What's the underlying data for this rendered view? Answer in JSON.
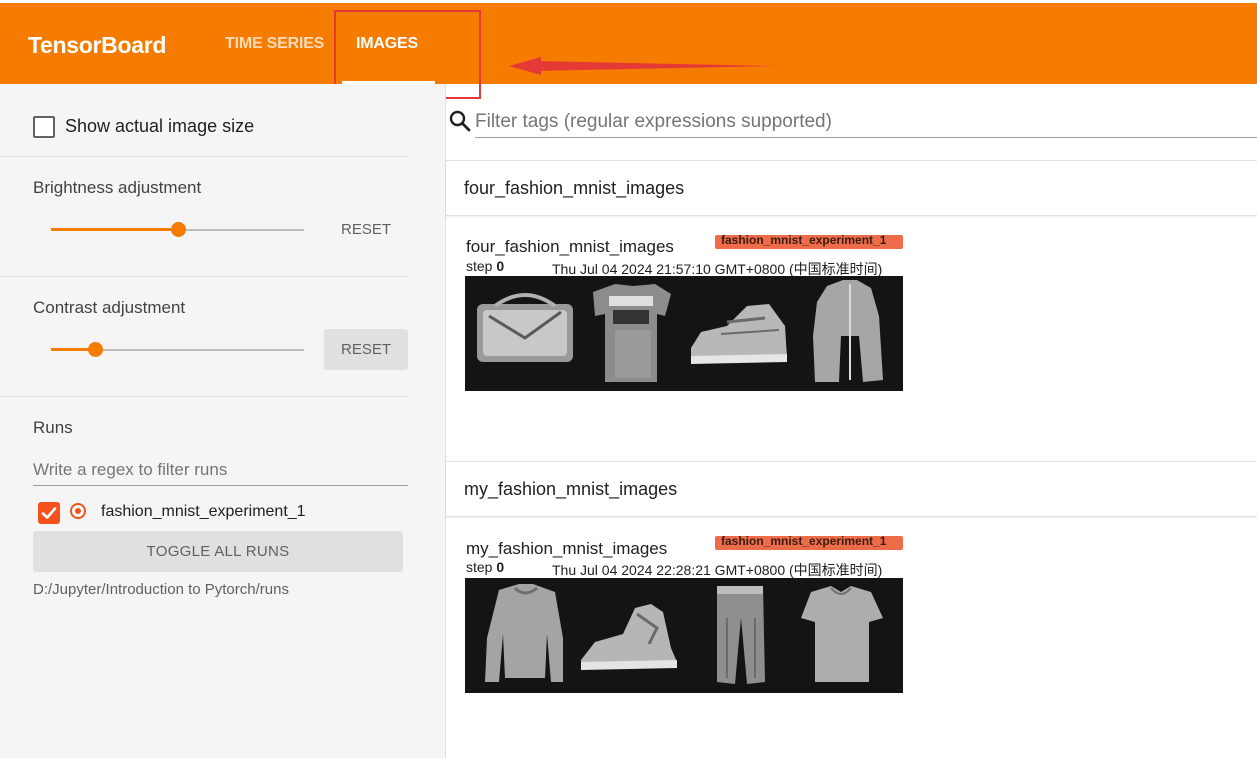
{
  "app": {
    "brand": "TensorBoard"
  },
  "nav": {
    "tabs": [
      {
        "label": "TIME SERIES",
        "active": false
      },
      {
        "label": "IMAGES",
        "active": true
      }
    ]
  },
  "colors": {
    "accent": "#f57c00",
    "run_color": "#f4511e",
    "annotation": "#e53935"
  },
  "sidebar": {
    "show_actual_size_label": "Show actual image size",
    "show_actual_size_checked": false,
    "brightness": {
      "label": "Brightness adjustment",
      "reset_label": "RESET",
      "level_fraction": 0.5
    },
    "contrast": {
      "label": "Contrast adjustment",
      "reset_label": "RESET",
      "level_fraction": 0.18
    },
    "runs": {
      "title": "Runs",
      "filter_placeholder": "Write a regex to filter runs",
      "items": [
        {
          "name": "fashion_mnist_experiment_1",
          "checked": true
        }
      ],
      "toggle_label": "TOGGLE ALL RUNS",
      "logdir": "D:/Jupyter/Introduction to Pytorch/runs"
    }
  },
  "main": {
    "tag_filter_placeholder": "Filter tags (regular expressions supported)",
    "search_icon": "search-icon",
    "groups": [
      {
        "title": "four_fashion_mnist_images",
        "card": {
          "title": "four_fashion_mnist_images",
          "run": "fashion_mnist_experiment_1",
          "step_label": "step",
          "step": "0",
          "timestamp": "Thu Jul 04 2024 21:57:10 GMT+0800 (中国标准时间)",
          "images": [
            "bag",
            "t-shirt",
            "sneaker",
            "coat"
          ]
        }
      },
      {
        "title": "my_fashion_mnist_images",
        "card": {
          "title": "my_fashion_mnist_images",
          "run": "fashion_mnist_experiment_1",
          "step_label": "step",
          "step": "0",
          "timestamp": "Thu Jul 04 2024 22:28:21 GMT+0800 (中国标准时间)",
          "images": [
            "pullover",
            "sneaker",
            "trouser",
            "t-shirt"
          ]
        }
      }
    ]
  }
}
